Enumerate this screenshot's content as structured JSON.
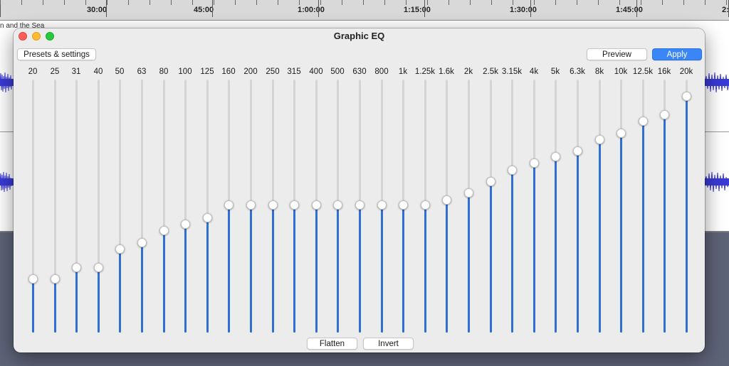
{
  "timeline": {
    "labels": [
      "30:00",
      "45:00",
      "1:00:00",
      "1:15:00",
      "1:30:00",
      "1:45:00",
      "2:"
    ]
  },
  "track": {
    "name": "n and the Sea"
  },
  "window": {
    "title": "Graphic EQ"
  },
  "toolbar": {
    "presets_label": "Presets & settings",
    "preview_label": "Preview",
    "apply_label": "Apply"
  },
  "footer": {
    "flatten_label": "Flatten",
    "invert_label": "Invert"
  },
  "colors": {
    "slider_fill": "#2f6fd6",
    "slider_track": "#d4d4d4",
    "apply_button": "#3b86f7",
    "waveform": "#3a3ad6"
  },
  "eq": {
    "bands": [
      {
        "label": "20",
        "level": 0.211
      },
      {
        "label": "25",
        "level": 0.211
      },
      {
        "label": "31",
        "level": 0.258
      },
      {
        "label": "40",
        "level": 0.258
      },
      {
        "label": "50",
        "level": 0.331
      },
      {
        "label": "63",
        "level": 0.354
      },
      {
        "label": "80",
        "level": 0.404
      },
      {
        "label": "100",
        "level": 0.427
      },
      {
        "label": "125",
        "level": 0.455
      },
      {
        "label": "160",
        "level": 0.503
      },
      {
        "label": "200",
        "level": 0.503
      },
      {
        "label": "250",
        "level": 0.503
      },
      {
        "label": "315",
        "level": 0.503
      },
      {
        "label": "400",
        "level": 0.503
      },
      {
        "label": "500",
        "level": 0.503
      },
      {
        "label": "630",
        "level": 0.503
      },
      {
        "label": "800",
        "level": 0.503
      },
      {
        "label": "1k",
        "level": 0.503
      },
      {
        "label": "1.25k",
        "level": 0.503
      },
      {
        "label": "1.6k",
        "level": 0.525
      },
      {
        "label": "2k",
        "level": 0.553
      },
      {
        "label": "2.5k",
        "level": 0.598
      },
      {
        "label": "3.15k",
        "level": 0.643
      },
      {
        "label": "4k",
        "level": 0.669
      },
      {
        "label": "5k",
        "level": 0.694
      },
      {
        "label": "6.3k",
        "level": 0.719
      },
      {
        "label": "8k",
        "level": 0.764
      },
      {
        "label": "10k",
        "level": 0.789
      },
      {
        "label": "12.5k",
        "level": 0.837
      },
      {
        "label": "16k",
        "level": 0.862
      },
      {
        "label": "20k",
        "level": 0.935
      }
    ]
  }
}
